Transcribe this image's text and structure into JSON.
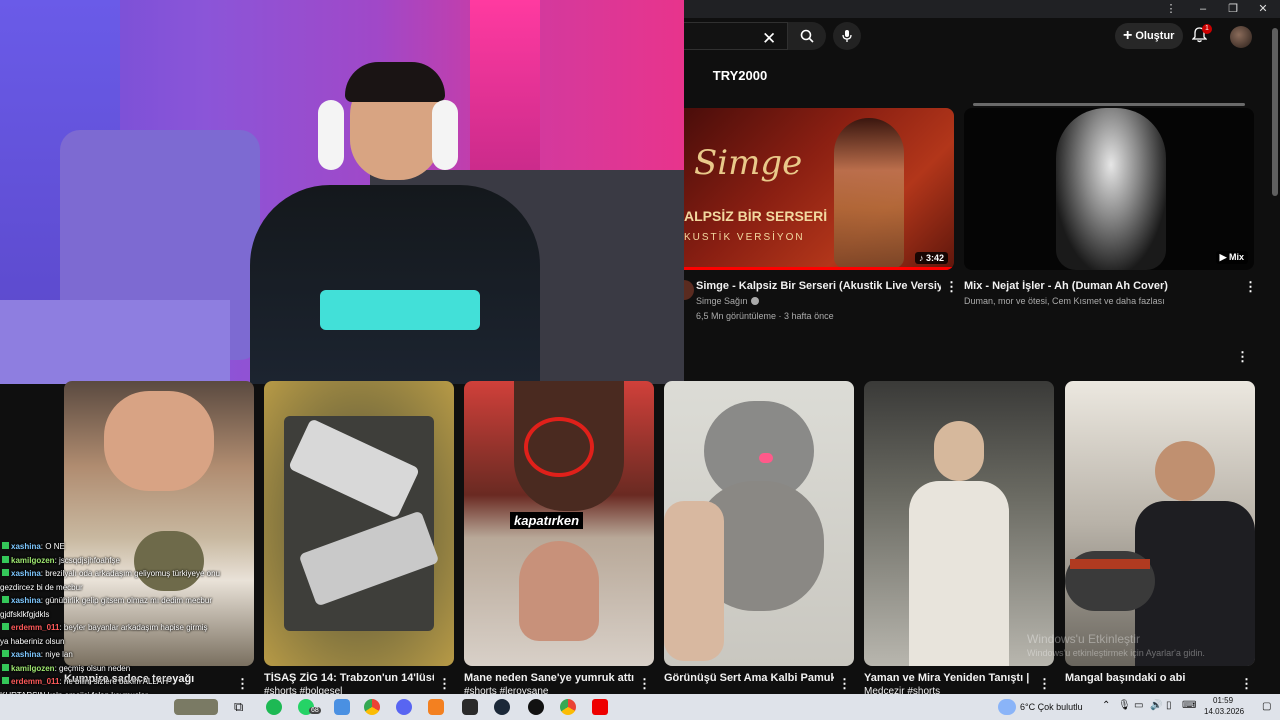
{
  "header": {
    "create_label": "Oluştur",
    "notification_count": "1"
  },
  "chips": [
    {
      "label": "TRY2000"
    }
  ],
  "videos": [
    {
      "title": "Simge - Kalpsiz Bir Serseri (Akustik Live Versiyon)",
      "channel": "Simge Sağın",
      "stats": "6,5 Mn görüntüleme · 3 hafta önce",
      "duration": "3:42",
      "thumb_text_1": "Simge",
      "thumb_text_2": "ALPSİZ BİR SERSERİ",
      "thumb_text_3": "KUSTİK VERSİYON"
    },
    {
      "title": "Mix - Nejat İşler -  Ah (Duman Ah Cover)",
      "channel": "Duman, mor ve ötesi, Cem Kısmet ve daha fazlası",
      "stats": "",
      "duration": "Mix"
    }
  ],
  "shorts": [
    {
      "title": "Kumpire sadece tereyağı",
      "sub": ""
    },
    {
      "title": "TİSAŞ ZİG 14: Trabzon'un 14'lüsü!",
      "sub": "#shorts #bolgesel"
    },
    {
      "title": "Mane neden Sane'ye yumruk attı?",
      "sub": "#shorts #leroysane",
      "thumb_text": "kapatırken"
    },
    {
      "title": "Görünüşü Sert Ama Kalbi Pamuk!",
      "sub": ""
    },
    {
      "title": "Yaman ve Mira Yeniden Tanıştı |",
      "sub": "Medcezir #shorts"
    },
    {
      "title": "Mangal başındaki o abi",
      "sub": ""
    }
  ],
  "chat": [
    {
      "user": "xashina",
      "msg": ": O NE",
      "color": "#7ec8ff"
    },
    {
      "user": "kamilgozen",
      "msg": ": jscsqdjsjhfoahfşe",
      "color": "#9fe870"
    },
    {
      "user": "xashina",
      "msg": ": brezilyalı oda arkadaşım geliyomuş türkiyeye onu",
      "color": "#7ec8ff"
    },
    {
      "user": "",
      "msg": "gezdircez bi de mecbur",
      "color": "#fff"
    },
    {
      "user": "xashina",
      "msg": ": günübirlik gelip gitsem olmaz mı dedim mecbur",
      "color": "#7ec8ff"
    },
    {
      "user": "",
      "msg": "gjdfsklkfgjdkls",
      "color": "#fff"
    },
    {
      "user": "erdemm_011",
      "msg": ": beyler bayanlar arkadaşım hapise girmiş",
      "color": "#ff5a5a"
    },
    {
      "user": "",
      "msg": "ya haberiniz olsun",
      "color": "#fff"
    },
    {
      "user": "xashina",
      "msg": ": niye lan",
      "color": "#7ec8ff"
    },
    {
      "user": "kamilgozen",
      "msg": ": geçmiş olsun neden",
      "color": "#9fe870"
    },
    {
      "user": "erdemm_011",
      "msg": ": ne bilim sizlere bakım ALLAH",
      "color": "#ff5a5a"
    },
    {
      "user": "",
      "msg": "KURTARSIN kalp emojisi falan koymuşlar",
      "color": "#fff"
    }
  ],
  "taskbar": {
    "badge_count": "68",
    "weather": "6°C  Çok bulutlu",
    "time": "01:59",
    "date": "14.03.2026"
  },
  "watermark": {
    "line1": "Windows'u Etkinleştir",
    "line2": "Windows'u etkinleştirmek için Ayarlar'a gidin."
  }
}
